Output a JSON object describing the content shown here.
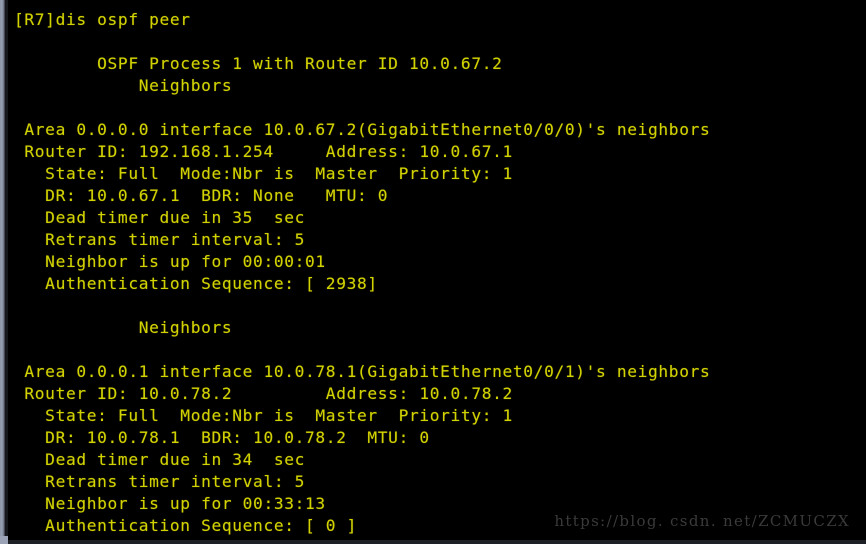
{
  "terminal": {
    "prompt_line": "[R7]dis ospf peer",
    "lines": [
      "[R7]dis ospf peer",
      "",
      "        OSPF Process 1 with Router ID 10.0.67.2",
      "            Neighbors",
      "",
      " Area 0.0.0.0 interface 10.0.67.2(GigabitEthernet0/0/0)'s neighbors",
      " Router ID: 192.168.1.254     Address: 10.0.67.1",
      "   State: Full  Mode:Nbr is  Master  Priority: 1",
      "   DR: 10.0.67.1  BDR: None   MTU: 0",
      "   Dead timer due in 35  sec",
      "   Retrans timer interval: 5",
      "   Neighbor is up for 00:00:01",
      "   Authentication Sequence: [ 2938]",
      "",
      "            Neighbors",
      "",
      " Area 0.0.0.1 interface 10.0.78.1(GigabitEthernet0/0/1)'s neighbors",
      " Router ID: 10.0.78.2         Address: 10.0.78.2",
      "   State: Full  Mode:Nbr is  Master  Priority: 1",
      "   DR: 10.0.78.1  BDR: 10.0.78.2  MTU: 0",
      "   Dead timer due in 34  sec",
      "   Retrans timer interval: 5",
      "   Neighbor is up for 00:33:13",
      "   Authentication Sequence: [ 0 ]"
    ],
    "ospf": {
      "process_id": "1",
      "router_id": "10.0.67.2",
      "neighbors": [
        {
          "area": "0.0.0.0",
          "interface_ip": "10.0.67.2",
          "interface_name": "GigabitEthernet0/0/0",
          "neighbor_router_id": "192.168.1.254",
          "neighbor_address": "10.0.67.1",
          "state": "Full",
          "mode": "Nbr is  Master",
          "priority": "1",
          "dr": "10.0.67.1",
          "bdr": "None",
          "mtu": "0",
          "dead_timer_sec": "35",
          "retrans_timer_interval": "5",
          "up_for": "00:00:01",
          "auth_sequence": "[ 2938]"
        },
        {
          "area": "0.0.0.1",
          "interface_ip": "10.0.78.1",
          "interface_name": "GigabitEthernet0/0/1",
          "neighbor_router_id": "10.0.78.2",
          "neighbor_address": "10.0.78.2",
          "state": "Full",
          "mode": "Nbr is  Master",
          "priority": "1",
          "dr": "10.0.78.1",
          "bdr": "10.0.78.2",
          "mtu": "0",
          "dead_timer_sec": "34",
          "retrans_timer_interval": "5",
          "up_for": "00:33:13",
          "auth_sequence": "[ 0 ]"
        }
      ]
    },
    "colors": {
      "background": "#000000",
      "text": "#d2d200",
      "watermark": "#3a3a3a",
      "gutter": "#96a0b2"
    }
  },
  "watermark": {
    "text": "https://blog. csdn. net/ZCMUCZX"
  }
}
